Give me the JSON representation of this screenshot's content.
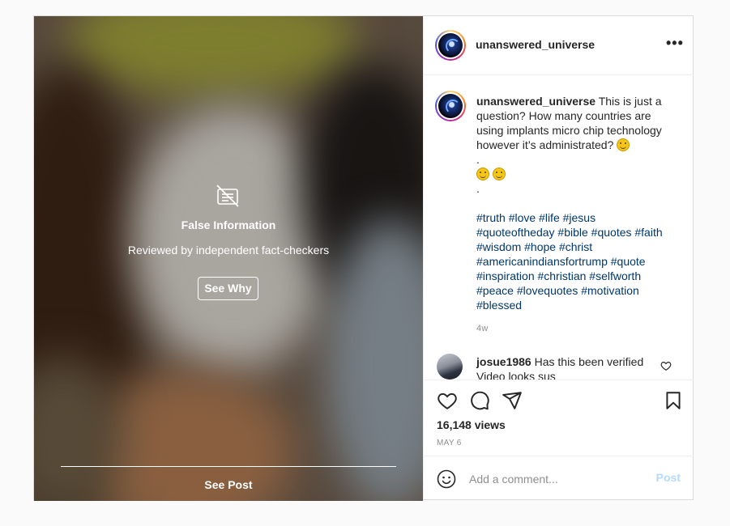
{
  "media": {
    "icon": "false-information-icon",
    "title": "False Information",
    "subtitle": "Reviewed by independent fact-checkers",
    "see_why_label": "See Why",
    "see_post_label": "See Post"
  },
  "header": {
    "username": "unanswered_universe",
    "more_icon": "more-horizontal-icon",
    "more_label": "•••"
  },
  "caption": {
    "username": "unanswered_universe",
    "text": "This is just a question? How many countries are using implants micro chip technology however it’s administrated?",
    "dot1": ".",
    "dot2": ".",
    "hashtags": "#truth #love #life #jesus #quoteoftheday #bible #quotes #faith #wisdom #hope #christ #americanindiansfortrump #quote #inspiration #christian #selfworth #peace #lovequotes #motivation #blessed",
    "time_ago": "4w"
  },
  "comment": {
    "username": "josue1986",
    "text": "Has this been verified Video looks sus"
  },
  "actions": {
    "icons": [
      "heart-icon",
      "comment-icon",
      "share-icon",
      "bookmark-icon"
    ],
    "views": "16,148 views",
    "date": "MAY 6"
  },
  "add_comment": {
    "placeholder": "Add a comment...",
    "post_label": "Post"
  },
  "colors": {
    "link": "#00376b",
    "muted": "#8e8e8e",
    "post_button_disabled": "#b3dbff",
    "border": "#dbdbdb"
  }
}
